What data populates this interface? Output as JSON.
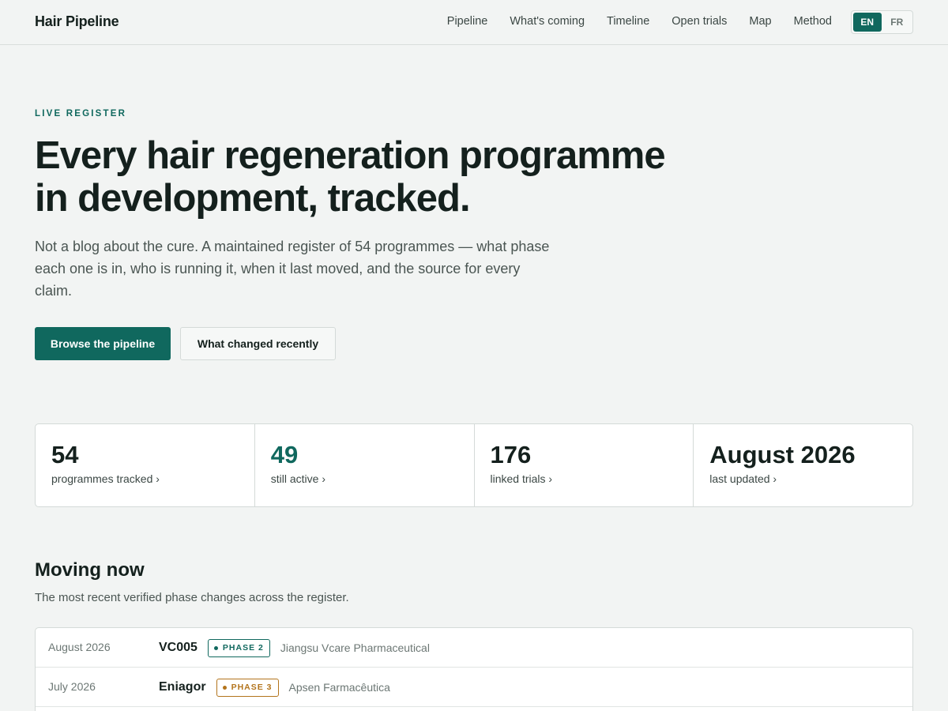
{
  "header": {
    "brand": "Hair Pipeline",
    "nav": [
      "Pipeline",
      "What's coming",
      "Timeline",
      "Open trials",
      "Map",
      "Method"
    ],
    "lang": {
      "active": "EN",
      "other": "FR"
    }
  },
  "hero": {
    "eyebrow": "LIVE REGISTER",
    "headline": "Every hair regeneration programme in development, tracked.",
    "lede": "Not a blog about the cure. A maintained register of 54 programmes — what phase each one is in, who is running it, when it last moved, and the source for every claim.",
    "primary_button": "Browse the pipeline",
    "secondary_button": "What changed recently"
  },
  "stats": [
    {
      "value": "54",
      "label": "programmes tracked ›"
    },
    {
      "value": "49",
      "label": "still active ›"
    },
    {
      "value": "176",
      "label": "linked trials ›"
    },
    {
      "value": "August 2026",
      "label": "last updated ›"
    }
  ],
  "moving_now": {
    "title": "Moving now",
    "subtitle": "The most recent verified phase changes across the register.",
    "rows": [
      {
        "date": "August 2026",
        "name": "VC005",
        "phase": "PHASE 2",
        "sponsor": "Jiangsu Vcare Pharmaceutical"
      },
      {
        "date": "July 2026",
        "name": "Eniagor",
        "phase": "PHASE 3",
        "sponsor": "Apsen Farmacêutica"
      }
    ]
  },
  "colors": {
    "accent": "#10685e",
    "phase3": "#b3741c",
    "background": "#f2f4f3"
  }
}
